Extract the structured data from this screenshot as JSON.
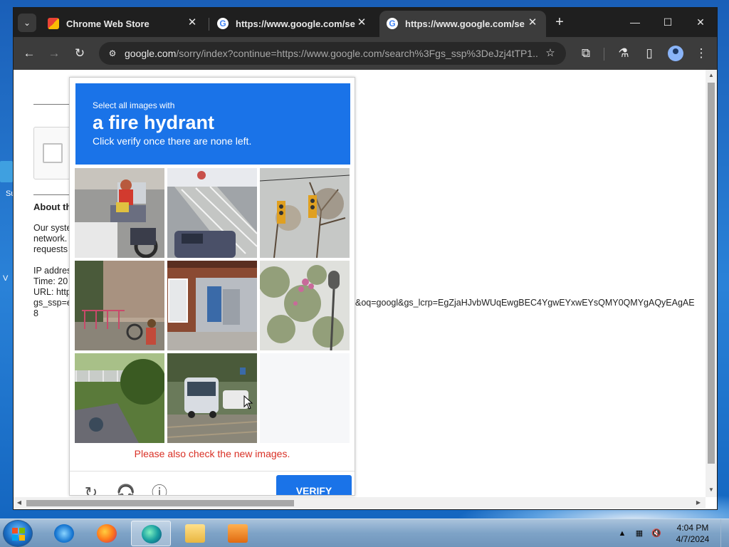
{
  "browser": {
    "tabs": [
      {
        "title": "Chrome Web Store",
        "favicon": "chrome-web-store-icon",
        "active": false
      },
      {
        "title": "https://www.google.com/search",
        "favicon": "google-icon",
        "active": false
      },
      {
        "title": "https://www.google.com/search",
        "favicon": "google-icon",
        "active": true
      }
    ],
    "tab_search_glyph": "⌄",
    "new_tab_glyph": "+",
    "window_controls": {
      "minimize": "—",
      "maximize": "☐",
      "close": "✕"
    },
    "tab_close_glyph": "✕",
    "address": {
      "host": "google.com",
      "path": "/sorry/index?continue=https://www.google.com/search%3Fgs_ssp%3DeJzj4tTP1..."
    },
    "nav": {
      "back": "←",
      "forward": "→",
      "reload": "↻",
      "star": "☆",
      "site_info": "⚙"
    },
    "toolbar_icons": {
      "extensions": "⧉",
      "labs": "⚗",
      "side_panel": "▯",
      "menu": "⋮"
    }
  },
  "page": {
    "about_heading": "About th",
    "body_lines": [
      "Our syste",
      "network.",
      "requests"
    ],
    "ip_lines": [
      "IP addres",
      "Time: 20",
      "URL: http",
      "gs_ssp=e",
      "8"
    ],
    "url_tail": "&oq=googl&gs_lcrp=EgZjaHJvbWUqEwgBEC4YgwEYxwEYsQMY0QMYgAQyEAgAE"
  },
  "captcha": {
    "instruction_line1": "Select all images with",
    "target_object": "a fire hydrant",
    "instruction_line3": "Click verify once there are none left.",
    "error_text": "Please also check the new images.",
    "verify_label": "VERIFY",
    "footer_icons": {
      "reload": "↻",
      "audio": "🎧",
      "info": "ⓘ"
    },
    "tiles": [
      {
        "name": "tile-motorbikes-street"
      },
      {
        "name": "tile-stairs-car"
      },
      {
        "name": "tile-traffic-lights"
      },
      {
        "name": "tile-house-porch"
      },
      {
        "name": "tile-garage-door"
      },
      {
        "name": "tile-tree-streetlight"
      },
      {
        "name": "tile-creek-bridge"
      },
      {
        "name": "tile-bus-street"
      },
      {
        "name": "tile-loading"
      }
    ]
  },
  "desktop": {
    "icon_label_fragment": "Su",
    "icon_label_fragment2": "V"
  },
  "taskbar": {
    "apps": [
      "internet-explorer-icon",
      "firefox-icon",
      "edge-icon",
      "file-explorer-icon",
      "media-player-icon"
    ],
    "clock_time": "4:04 PM",
    "clock_date": "4/7/2024",
    "tray_icons": {
      "show_hidden": "▲",
      "network": "▦",
      "volume_muted": "🔇"
    }
  },
  "colors": {
    "captcha_blue": "#1a73e8",
    "error_red": "#d93025",
    "chrome_dark": "#1f1f1f",
    "desktop_blue": "#1e6fc7"
  }
}
